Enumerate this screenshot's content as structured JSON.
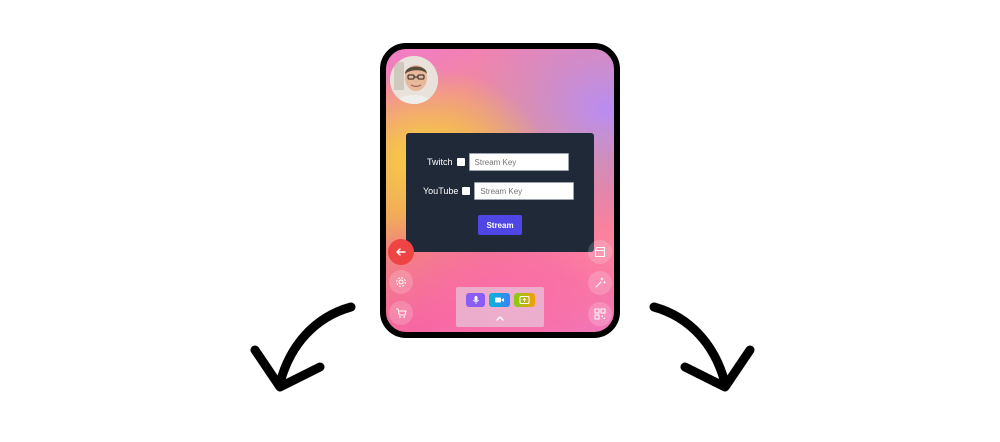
{
  "panel": {
    "twitch": {
      "label": "Twitch",
      "placeholder": "Stream Key"
    },
    "youtube": {
      "label": "YouTube",
      "placeholder": "Stream Key"
    },
    "stream_label": "Stream"
  },
  "icons": {
    "back": "arrow-left-icon",
    "settings": "gear-icon",
    "cart": "shopping-cart-icon",
    "clapper": "clapperboard-icon",
    "effects": "magic-sparkle-icon",
    "qr": "qr-code-icon",
    "mic": "microphone-icon",
    "camera": "video-camera-icon",
    "screen": "screen-share-icon",
    "expand": "chevron-up-icon"
  },
  "colors": {
    "panel_bg": "#1f2937",
    "stream_button": "#4f46e5",
    "back_button": "#ef4444",
    "mic_tool": "#8b5cf6",
    "camera_tool": "#06b6d4",
    "screen_tool": "#84cc16"
  }
}
